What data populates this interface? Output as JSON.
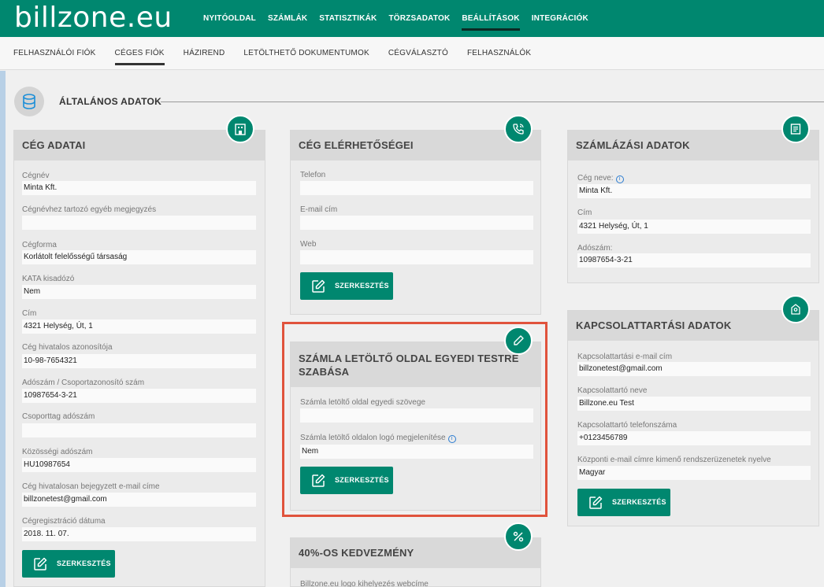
{
  "app": {
    "logo": "billzone.eu"
  },
  "main_menu": [
    {
      "label": "NYITÓOLDAL"
    },
    {
      "label": "SZÁMLÁK"
    },
    {
      "label": "STATISZTIKÁK"
    },
    {
      "label": "TÖRZSADATOK"
    },
    {
      "label": "BEÁLLÍTÁSOK",
      "active": true
    },
    {
      "label": "INTEGRÁCIÓK"
    }
  ],
  "sub_menu": [
    {
      "label": "FELHASZNÁLÓI FIÓK"
    },
    {
      "label": "CÉGES FIÓK",
      "active": true
    },
    {
      "label": "HÁZIREND"
    },
    {
      "label": "LETÖLTHETŐ DOKUMENTUMOK"
    },
    {
      "label": "CÉGVÁLASZTÓ"
    },
    {
      "label": "FELHASZNÁLÓK"
    }
  ],
  "section": {
    "title": "ÁLTALÁNOS ADATOK",
    "icon": "database-icon"
  },
  "colors": {
    "brand": "#00876f",
    "highlight": "#e0533c",
    "info": "#2a7bd1"
  },
  "edit_label": "SZERKESZTÉS",
  "company_data": {
    "title": "CÉG ADATAI",
    "icon": "building-icon",
    "fields": [
      {
        "label": "Cégnév",
        "value": "Minta Kft."
      },
      {
        "label": "Cégnévhez tartozó egyéb megjegyzés",
        "value": ""
      },
      {
        "label": "Cégforma",
        "value": "Korlátolt felelősségű társaság"
      },
      {
        "label": "KATA kisadózó",
        "value": "Nem"
      },
      {
        "label": "Cím",
        "value": "4321 Helység, Út, 1"
      },
      {
        "label": "Cég hivatalos azonosítója",
        "value": "10-98-7654321"
      },
      {
        "label": "Adószám / Csoportazonosító szám",
        "value": "10987654-3-21"
      },
      {
        "label": "Csoporttag adószám",
        "value": ""
      },
      {
        "label": "Közösségi adószám",
        "value": "HU10987654"
      },
      {
        "label": "Cég hivatalosan bejegyzett e-mail címe",
        "value": "billzonetest@gmail.com"
      },
      {
        "label": "Cégregisztráció dátuma",
        "value": "2018. 11. 07."
      }
    ]
  },
  "contact_info": {
    "title": "CÉG ELÉRHETŐSÉGEI",
    "icon": "phone-icon",
    "fields": [
      {
        "label": "Telefon",
        "value": ""
      },
      {
        "label": "E-mail cím",
        "value": ""
      },
      {
        "label": "Web",
        "value": ""
      }
    ]
  },
  "invoice_page": {
    "title_line1": "SZÁMLA LETÖLTŐ OLDAL EGYEDI TESTRE",
    "title_line2": "SZABÁSA",
    "icon": "pencil-icon",
    "fields": [
      {
        "label": "Számla letöltő oldal egyedi szövege",
        "value": ""
      },
      {
        "label": "Számla letöltő oldalon logó megjelenítése",
        "value": "Nem"
      }
    ]
  },
  "discount": {
    "title": "40%-OS KEDVEZMÉNY",
    "icon": "percent-icon",
    "fields": [
      {
        "label": "Billzone.eu logo kihelyezés webcíme"
      }
    ]
  },
  "billing_data": {
    "title": "SZÁMLÁZÁSI ADATOK",
    "icon": "invoice-icon",
    "fields": [
      {
        "label": "Cég neve:",
        "value": "Minta Kft."
      },
      {
        "label": "Cím",
        "value": "4321 Helység, Út, 1"
      },
      {
        "label": "Adószám:",
        "value": "10987654-3-21"
      }
    ]
  },
  "contact_person": {
    "title": "KAPCSOLATTARTÁSI ADATOK",
    "icon": "location-pin-icon",
    "fields": [
      {
        "label": "Kapcsolattartási e-mail cím",
        "value": "billzonetest@gmail.com"
      },
      {
        "label": "Kapcsolattartó neve",
        "value": "Billzone.eu Test"
      },
      {
        "label": "Kapcsolattartó telefonszáma",
        "value": "+0123456789"
      },
      {
        "label": "Központi e-mail címre kimenő rendszerüzenetek nyelve",
        "value": "Magyar"
      }
    ]
  }
}
